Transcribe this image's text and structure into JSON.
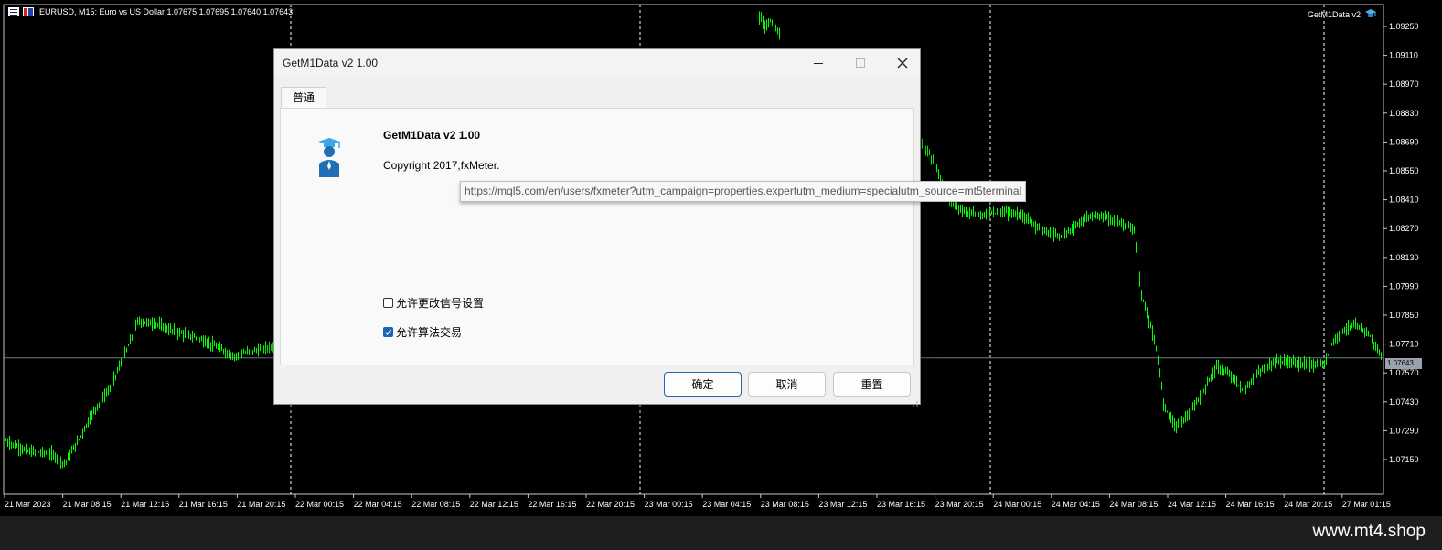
{
  "chart_header": {
    "text": "EURUSD, M15:  Euro vs US Dollar  1.07675 1.07695 1.07640 1.07643"
  },
  "ea_badge": {
    "label": "GetM1Data v2",
    "icon": "graduation-cap-icon"
  },
  "price_axis": {
    "labels": [
      "1.09250",
      "1.09110",
      "1.08970",
      "1.08830",
      "1.08690",
      "1.08550",
      "1.08410",
      "1.08270",
      "1.08130",
      "1.07990",
      "1.07850",
      "1.07710",
      "1.07570",
      "1.07430",
      "1.07290",
      "1.07150"
    ],
    "current_price": "1.07643"
  },
  "time_axis": {
    "labels": [
      "21 Mar 2023",
      "21 Mar 08:15",
      "21 Mar 12:15",
      "21 Mar 16:15",
      "21 Mar 20:15",
      "22 Mar 00:15",
      "22 Mar 04:15",
      "22 Mar 08:15",
      "22 Mar 12:15",
      "22 Mar 16:15",
      "22 Mar 20:15",
      "23 Mar 00:15",
      "23 Mar 04:15",
      "23 Mar 08:15",
      "23 Mar 12:15",
      "23 Mar 16:15",
      "23 Mar 20:15",
      "24 Mar 00:15",
      "24 Mar 04:15",
      "24 Mar 08:15",
      "24 Mar 12:15",
      "24 Mar 16:15",
      "24 Mar 20:15",
      "27 Mar 01:15"
    ]
  },
  "dialog": {
    "title": "GetM1Data v2 1.00",
    "tab": "普通",
    "ea_name": "GetM1Data v2 1.00",
    "copyright": "Copyright 2017,fxMeter.",
    "link_tooltip": "https://mql5.com/en/users/fxmeter?utm_campaign=properties.expertutm_medium=specialutm_source=mt5terminal",
    "checkbox_signal": {
      "label": "允许更改信号设置",
      "checked": false
    },
    "checkbox_algo": {
      "label": "允许算法交易",
      "checked": true
    },
    "ok_label": "确定",
    "cancel_label": "取消",
    "reset_label": "重置"
  },
  "watermark": "www.mt4.shop",
  "colors": {
    "background": "#000000",
    "candle": "#00ff00",
    "accent": "#1e63b8"
  }
}
